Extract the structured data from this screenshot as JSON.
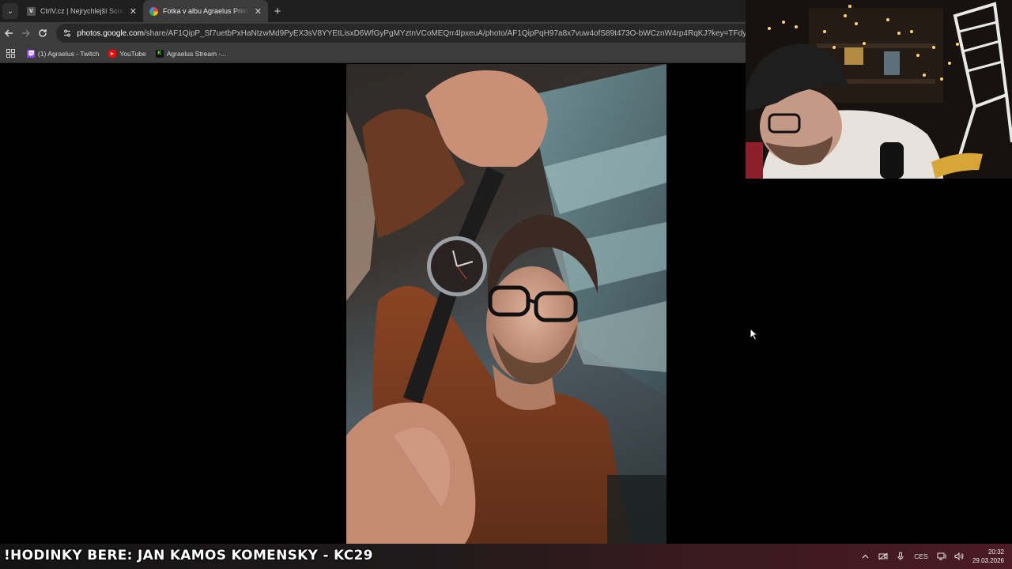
{
  "browser": {
    "tabs": [
      {
        "title": "CtrlV.cz | Nejrychlejší ScreenSh",
        "favicon": "ctrlv-favicon",
        "favicon_letter": "V",
        "active": false
      },
      {
        "title": "Fotka v albu Agraelus Prim - Fo",
        "favicon": "google-photos-favicon",
        "active": true
      }
    ],
    "tab_close_glyph": "✕",
    "new_tab_glyph": "+",
    "url": {
      "domain": "photos.google.com",
      "path": "/share/AF1QipP_Sf7uetbPxHaNtzwMd9PyEX3sV8YYEtLisxD6WfGyPgMYztnVCoMEQrr4lpxeuA/photo/AF1QipPqH97a8x7vuw4ofS89t473O-bWCznW4rp4RqKJ?key=TFdyUVZwRnBJbURGb"
    },
    "bookmarks": [
      {
        "label": "(1) Agraelus - Twitch",
        "icon": "twitch-icon"
      },
      {
        "label": "YouTube",
        "icon": "youtube-icon"
      },
      {
        "label": "Agraelus Stream -...",
        "icon": "kick-icon",
        "icon_letter": "K"
      }
    ]
  },
  "overlay": {
    "ticker_text": "!HODINKY BERE: JAN  KAMOS  KOMENSKY - KC29"
  },
  "taskbar": {
    "language": "CES",
    "time": "20:32",
    "date": "29.03.2026"
  },
  "colors": {
    "chrome_dark": "#1f1f1f",
    "chrome_toolbar": "#3c3c3c",
    "omnibox": "#282828",
    "taskbar_accent": "#4a1b22"
  }
}
